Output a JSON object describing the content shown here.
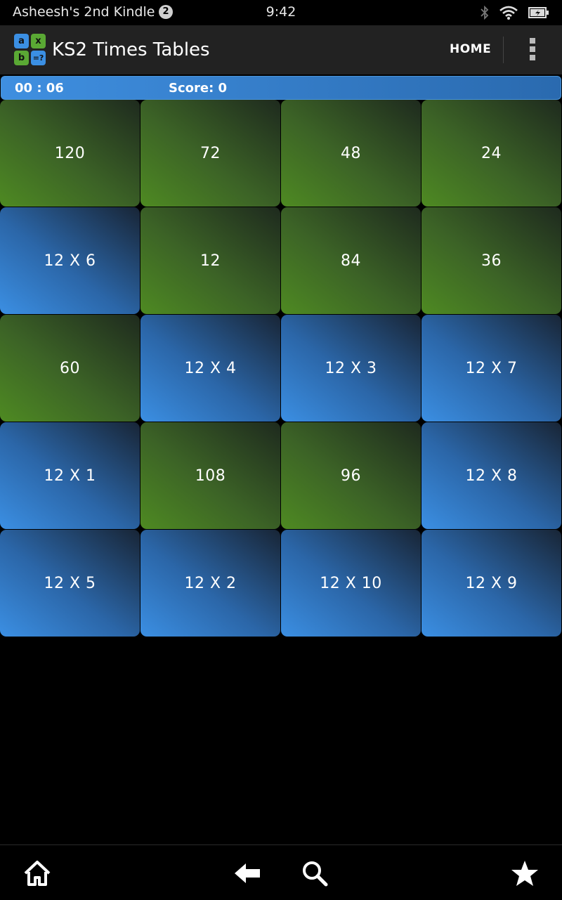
{
  "status_bar": {
    "device_name": "Asheesh's 2nd Kindle",
    "notification_count": "2",
    "time": "9:42",
    "icons": [
      "bluetooth-icon",
      "wifi-icon",
      "battery-charging-icon"
    ]
  },
  "action_bar": {
    "logo_cells": [
      "a",
      "x",
      "b",
      "=?"
    ],
    "title": "KS2 Times Tables",
    "home_label": "HOME",
    "overflow_icon": "overflow-menu-icon"
  },
  "game": {
    "timer": "00 : 06",
    "score": "Score: 0"
  },
  "tiles": [
    {
      "text": "120",
      "kind": "answer"
    },
    {
      "text": "72",
      "kind": "answer"
    },
    {
      "text": "48",
      "kind": "answer"
    },
    {
      "text": "24",
      "kind": "answer"
    },
    {
      "text": "12 X 6",
      "kind": "question"
    },
    {
      "text": "12",
      "kind": "answer"
    },
    {
      "text": "84",
      "kind": "answer"
    },
    {
      "text": "36",
      "kind": "answer"
    },
    {
      "text": "60",
      "kind": "answer"
    },
    {
      "text": "12 X 4",
      "kind": "question"
    },
    {
      "text": "12 X 3",
      "kind": "question"
    },
    {
      "text": "12 X 7",
      "kind": "question"
    },
    {
      "text": "12 X 1",
      "kind": "question"
    },
    {
      "text": "108",
      "kind": "answer"
    },
    {
      "text": "96",
      "kind": "answer"
    },
    {
      "text": "12 X 8",
      "kind": "question"
    },
    {
      "text": "12 X 5",
      "kind": "question"
    },
    {
      "text": "12 X 2",
      "kind": "question"
    },
    {
      "text": "12 X 10",
      "kind": "question"
    },
    {
      "text": "12 X 9",
      "kind": "question"
    }
  ],
  "nav_bar": {
    "icons": [
      "home-icon",
      "back-icon",
      "search-icon",
      "favorites-star-icon"
    ]
  },
  "colors": {
    "answer_tile": "#4e8a22",
    "question_tile": "#3b8fe3",
    "game_bar": "#3f8fe0",
    "action_bar": "#222222"
  }
}
